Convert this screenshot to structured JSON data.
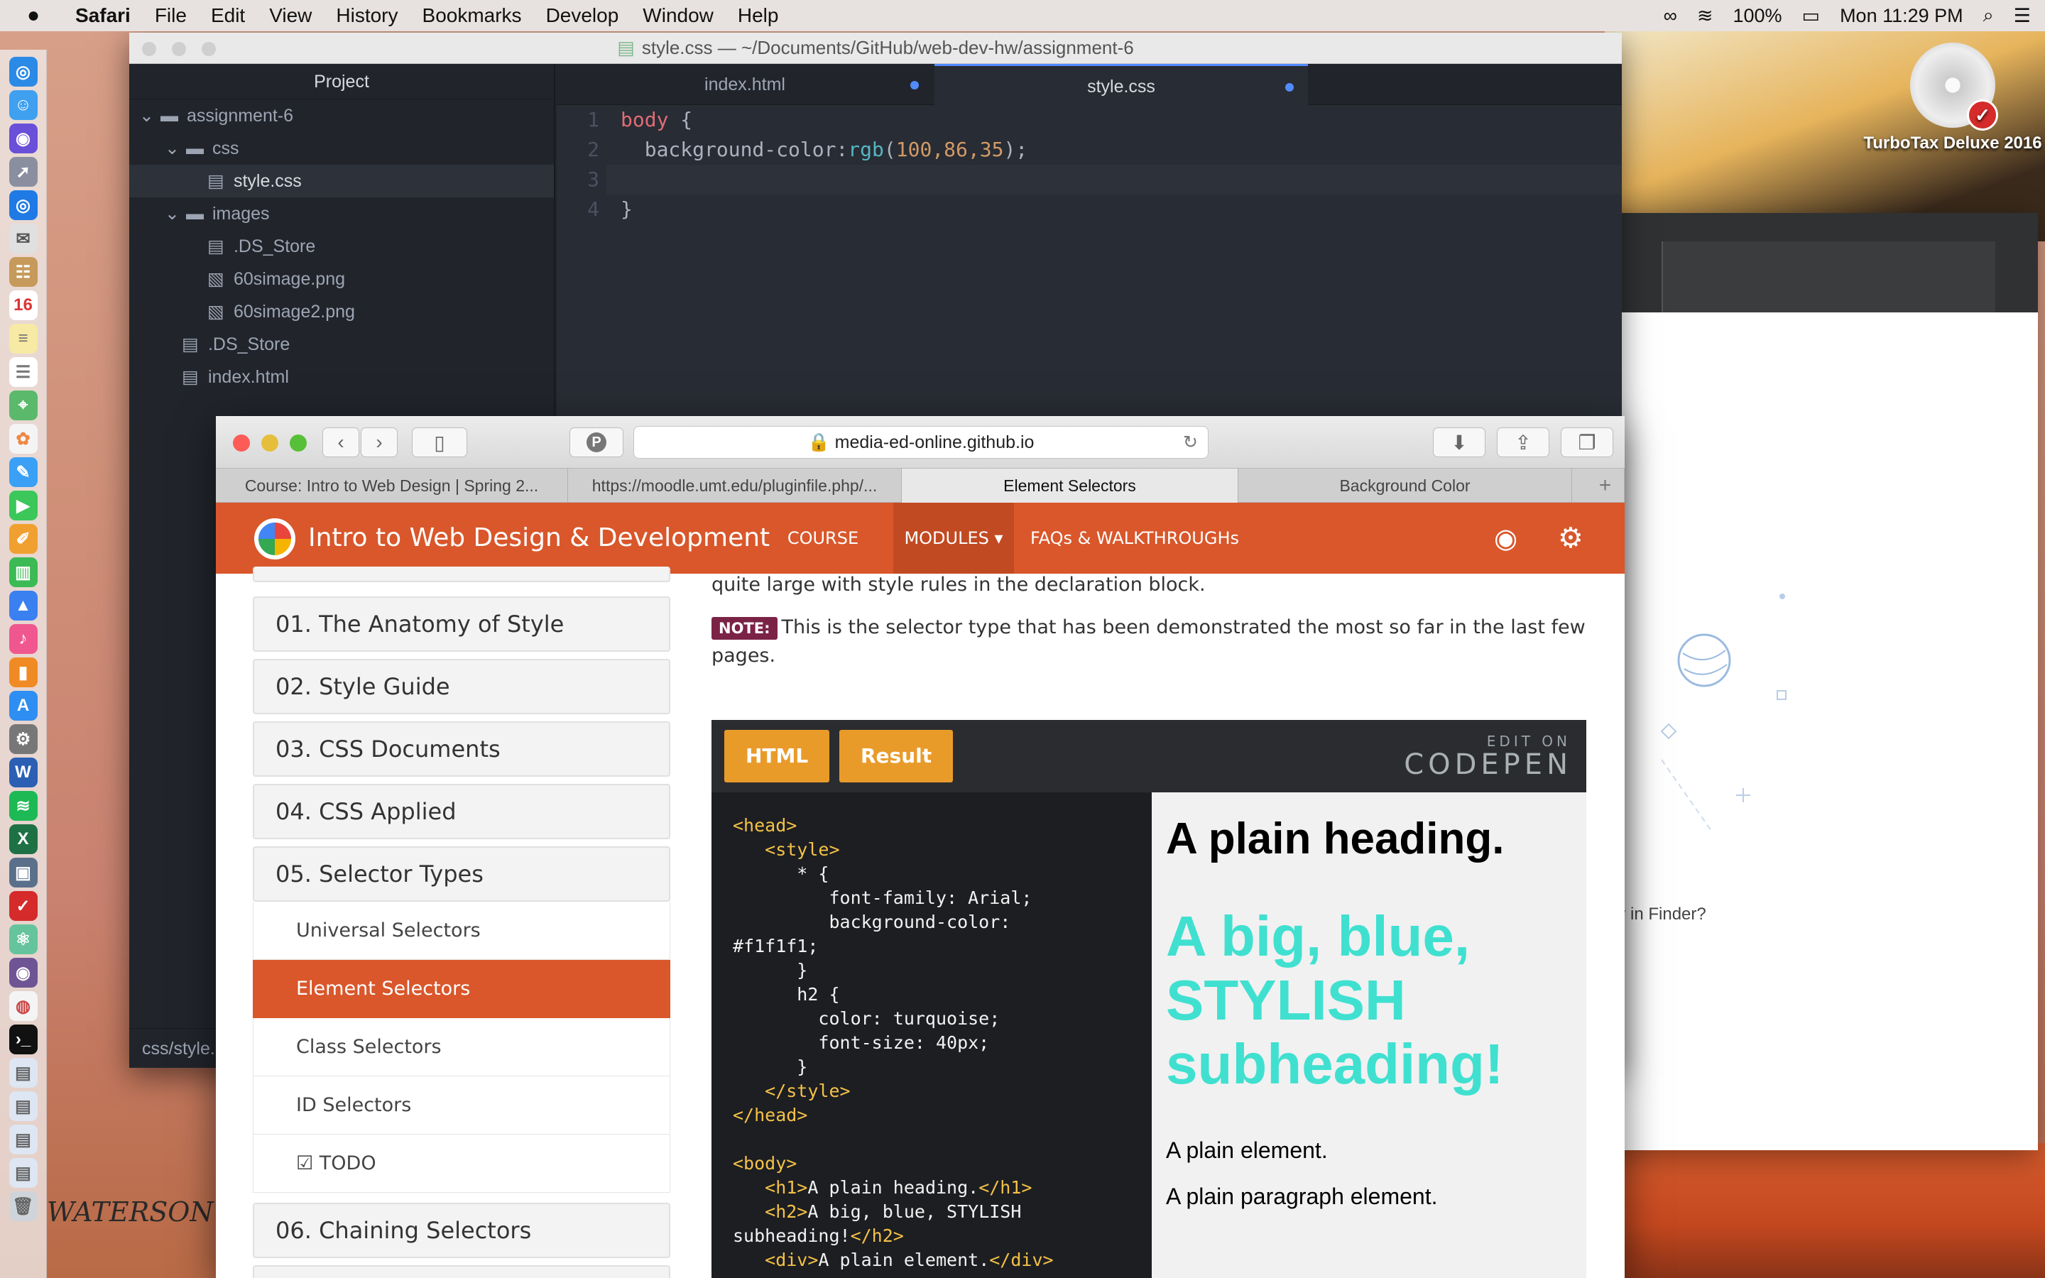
{
  "menubar": {
    "apple": "",
    "app": "Safari",
    "items": [
      "File",
      "Edit",
      "View",
      "History",
      "Bookmarks",
      "Develop",
      "Window",
      "Help"
    ],
    "battery": "100%",
    "clock": "Mon 11:29 PM"
  },
  "desktop": {
    "turbotax_label": "TurboTax Deluxe 2016",
    "finder_text_link": "ory",
    "finder_text_rest": " in Finder?",
    "signature": "WATERSON"
  },
  "atom": {
    "title": "style.css — ~/Documents/GitHub/web-dev-hw/assignment-6",
    "tree_header": "Project",
    "tree": [
      {
        "label": "assignment-6",
        "type": "folder",
        "open": true
      },
      {
        "label": "css",
        "type": "folder",
        "open": true
      },
      {
        "label": "style.css",
        "type": "file"
      },
      {
        "label": "images",
        "type": "folder",
        "open": true
      },
      {
        "label": ".DS_Store",
        "type": "file"
      },
      {
        "label": "60simage.png",
        "type": "image"
      },
      {
        "label": "60simage2.png",
        "type": "image"
      },
      {
        "label": ".DS_Store",
        "type": "file"
      },
      {
        "label": "index.html",
        "type": "file"
      }
    ],
    "tabs": [
      {
        "label": "index.html",
        "modified": true
      },
      {
        "label": "style.css",
        "modified": true,
        "active": true
      }
    ],
    "line_numbers": [
      "1",
      "2",
      "3",
      "4"
    ],
    "code": {
      "l1_selector": "body",
      "l1_brace": " {",
      "l2_prop": "  background-color:",
      "l2_fn": "rgb",
      "l2_open": "(",
      "l2_args": "100,86,35",
      "l2_close": ");",
      "l4": "}"
    },
    "status_path": "css/style."
  },
  "safari": {
    "url": "media-ed-online.github.io",
    "tabs": [
      {
        "label": "Course: Intro to Web Design | Spring 2..."
      },
      {
        "label": "https://moodle.umt.edu/pluginfile.php/..."
      },
      {
        "label": "Element Selectors",
        "active": true
      },
      {
        "label": "Background Color"
      }
    ],
    "new_tab": "+"
  },
  "site": {
    "title": "Intro to Web Design & Development",
    "nav": [
      "COURSE INFO",
      "MODULES ▾",
      "FAQs & WALKTHROUGHs"
    ],
    "sidebar": [
      "01. The Anatomy of Style",
      "02. Style Guide",
      "03. CSS Documents",
      "04. CSS Applied",
      "05. Selector Types"
    ],
    "subitems": [
      "Universal Selectors",
      "Element Selectors",
      "Class Selectors",
      "ID Selectors",
      "☑ TODO"
    ],
    "sidebar_next": "06. Chaining Selectors",
    "intro_text": "quite large with style rules in the declaration block.",
    "note_badge": "NOTE:",
    "note_text": "This is the selector type that has been demonstrated the most so far in the last few pages."
  },
  "codepen": {
    "html_tab": "HTML",
    "result_tab": "Result",
    "edit_on": "EDIT ON",
    "brand": "CODEPEN",
    "code_lines": [
      "<head>",
      "   <style>",
      "      * {",
      "         font-family: Arial;",
      "         background-color:",
      "#f1f1f1;",
      "      }",
      "      h2 {",
      "        color: turquoise;",
      "        font-size: 40px;",
      "      }",
      "   </style>",
      "</head>",
      "",
      "<body>",
      "   <h1>A plain heading.</h1>",
      "   <h2>A big, blue, STYLISH",
      "subheading!</h2>",
      "   <div>A plain element.</div>"
    ],
    "result": {
      "h1": "A plain heading.",
      "h2": "A big, blue, STYLISH subheading!",
      "div": "A plain element.",
      "p": "A plain paragraph element."
    }
  }
}
